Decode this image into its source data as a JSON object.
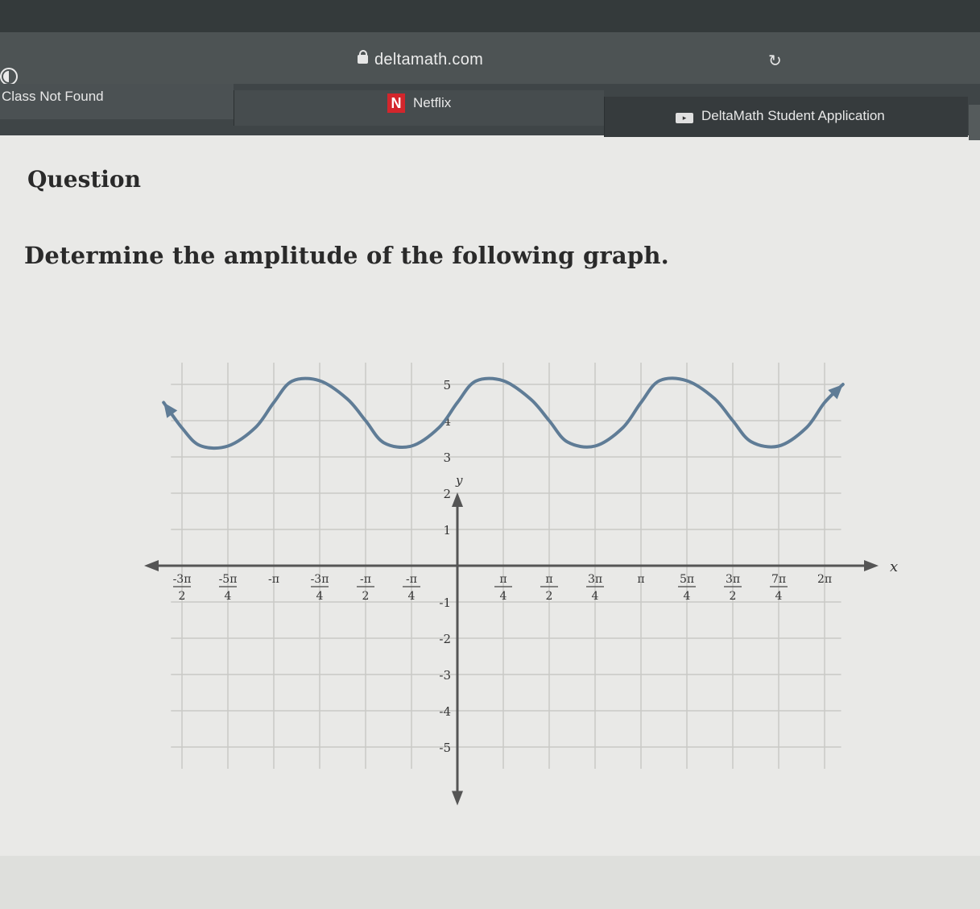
{
  "browser": {
    "url": "deltamath.com",
    "icons": {
      "sidebar": "sidebar-toggle-icon",
      "lock": "lock-icon",
      "reload": "reload-icon"
    },
    "tabs": [
      {
        "label": "Class Not Found"
      },
      {
        "label": "Netflix",
        "icon": "netflix-icon",
        "icon_text": "N"
      },
      {
        "label": "DeltaMath Student Application",
        "icon": "deltamath-icon"
      }
    ]
  },
  "page": {
    "title": "Question",
    "prompt": "Determine the amplitude of the following graph."
  },
  "colors": {
    "curve": "#5f7c96",
    "axis": "#555555",
    "grid": "#c9c9c6"
  },
  "chart_data": {
    "type": "line",
    "title": "",
    "xlabel": "x",
    "ylabel": "y",
    "xlim": [
      -1.75,
      2.25
    ],
    "ylim": [
      -5.5,
      5.8
    ],
    "xlim_units": "multiples of pi",
    "grid": true,
    "x_ticks": [
      {
        "value": -1.5,
        "num": "-3π",
        "den": "2"
      },
      {
        "value": -1.25,
        "num": "-5π",
        "den": "4"
      },
      {
        "value": -1.0,
        "num": "-π",
        "den": ""
      },
      {
        "value": -0.75,
        "num": "-3π",
        "den": "4"
      },
      {
        "value": -0.5,
        "num": "-π",
        "den": "2"
      },
      {
        "value": -0.25,
        "num": "-π",
        "den": "4"
      },
      {
        "value": 0.25,
        "num": "π",
        "den": "4"
      },
      {
        "value": 0.5,
        "num": "π",
        "den": "2"
      },
      {
        "value": 0.75,
        "num": "3π",
        "den": "4"
      },
      {
        "value": 1.0,
        "num": "π",
        "den": ""
      },
      {
        "value": 1.25,
        "num": "5π",
        "den": "4"
      },
      {
        "value": 1.5,
        "num": "3π",
        "den": "2"
      },
      {
        "value": 1.75,
        "num": "7π",
        "den": "4"
      },
      {
        "value": 2.0,
        "num": "2π",
        "den": ""
      }
    ],
    "y_ticks": [
      {
        "value": 5,
        "label": "5"
      },
      {
        "value": 4,
        "label": "4"
      },
      {
        "value": 3,
        "label": "3"
      },
      {
        "value": 2,
        "label": "2"
      },
      {
        "value": 1,
        "label": "1"
      },
      {
        "value": -1,
        "label": "-1"
      },
      {
        "value": -2,
        "label": "-2"
      },
      {
        "value": -3,
        "label": "-3"
      },
      {
        "value": -4,
        "label": "-4"
      },
      {
        "value": -5,
        "label": "-5"
      }
    ],
    "series": [
      {
        "x": [
          -1.6,
          -1.5,
          -1.4,
          -1.25,
          -1.1,
          -1.0,
          -0.9,
          -0.75,
          -0.6,
          -0.5,
          -0.4,
          -0.25,
          -0.1,
          0.0,
          0.1,
          0.25,
          0.4,
          0.5,
          0.6,
          0.75,
          0.9,
          1.0,
          1.1,
          1.25,
          1.4,
          1.5,
          1.6,
          1.75,
          1.9,
          2.0,
          2.1
        ],
        "y": [
          4.5,
          3.8,
          3.31,
          3.3,
          3.81,
          4.5,
          5.09,
          5.1,
          4.6,
          4.0,
          3.39,
          3.3,
          3.81,
          4.5,
          5.09,
          5.1,
          4.59,
          4.0,
          3.41,
          3.3,
          3.8,
          4.5,
          5.1,
          5.1,
          4.61,
          4.0,
          3.42,
          3.3,
          3.8,
          4.5,
          5.0
        ],
        "arrow_ends": true
      }
    ]
  }
}
